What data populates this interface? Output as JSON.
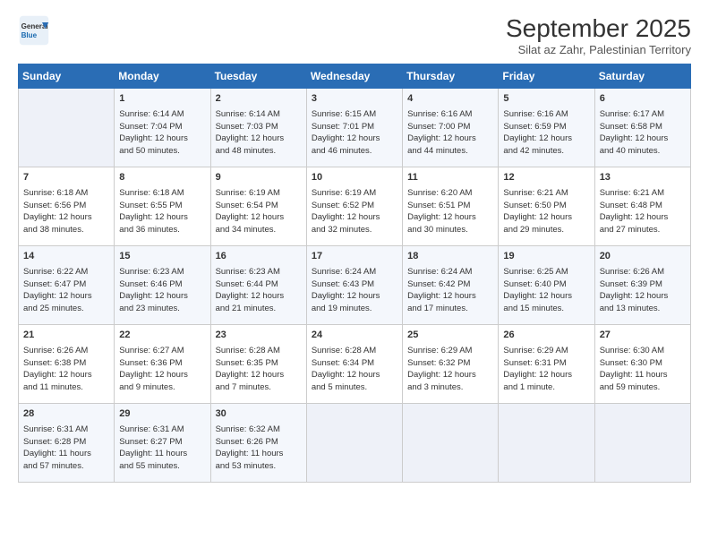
{
  "header": {
    "logo_general": "General",
    "logo_blue": "Blue",
    "month_title": "September 2025",
    "subtitle": "Silat az Zahr, Palestinian Territory"
  },
  "days_of_week": [
    "Sunday",
    "Monday",
    "Tuesday",
    "Wednesday",
    "Thursday",
    "Friday",
    "Saturday"
  ],
  "weeks": [
    [
      {
        "day": "",
        "info": ""
      },
      {
        "day": "1",
        "info": "Sunrise: 6:14 AM\nSunset: 7:04 PM\nDaylight: 12 hours\nand 50 minutes."
      },
      {
        "day": "2",
        "info": "Sunrise: 6:14 AM\nSunset: 7:03 PM\nDaylight: 12 hours\nand 48 minutes."
      },
      {
        "day": "3",
        "info": "Sunrise: 6:15 AM\nSunset: 7:01 PM\nDaylight: 12 hours\nand 46 minutes."
      },
      {
        "day": "4",
        "info": "Sunrise: 6:16 AM\nSunset: 7:00 PM\nDaylight: 12 hours\nand 44 minutes."
      },
      {
        "day": "5",
        "info": "Sunrise: 6:16 AM\nSunset: 6:59 PM\nDaylight: 12 hours\nand 42 minutes."
      },
      {
        "day": "6",
        "info": "Sunrise: 6:17 AM\nSunset: 6:58 PM\nDaylight: 12 hours\nand 40 minutes."
      }
    ],
    [
      {
        "day": "7",
        "info": "Sunrise: 6:18 AM\nSunset: 6:56 PM\nDaylight: 12 hours\nand 38 minutes."
      },
      {
        "day": "8",
        "info": "Sunrise: 6:18 AM\nSunset: 6:55 PM\nDaylight: 12 hours\nand 36 minutes."
      },
      {
        "day": "9",
        "info": "Sunrise: 6:19 AM\nSunset: 6:54 PM\nDaylight: 12 hours\nand 34 minutes."
      },
      {
        "day": "10",
        "info": "Sunrise: 6:19 AM\nSunset: 6:52 PM\nDaylight: 12 hours\nand 32 minutes."
      },
      {
        "day": "11",
        "info": "Sunrise: 6:20 AM\nSunset: 6:51 PM\nDaylight: 12 hours\nand 30 minutes."
      },
      {
        "day": "12",
        "info": "Sunrise: 6:21 AM\nSunset: 6:50 PM\nDaylight: 12 hours\nand 29 minutes."
      },
      {
        "day": "13",
        "info": "Sunrise: 6:21 AM\nSunset: 6:48 PM\nDaylight: 12 hours\nand 27 minutes."
      }
    ],
    [
      {
        "day": "14",
        "info": "Sunrise: 6:22 AM\nSunset: 6:47 PM\nDaylight: 12 hours\nand 25 minutes."
      },
      {
        "day": "15",
        "info": "Sunrise: 6:23 AM\nSunset: 6:46 PM\nDaylight: 12 hours\nand 23 minutes."
      },
      {
        "day": "16",
        "info": "Sunrise: 6:23 AM\nSunset: 6:44 PM\nDaylight: 12 hours\nand 21 minutes."
      },
      {
        "day": "17",
        "info": "Sunrise: 6:24 AM\nSunset: 6:43 PM\nDaylight: 12 hours\nand 19 minutes."
      },
      {
        "day": "18",
        "info": "Sunrise: 6:24 AM\nSunset: 6:42 PM\nDaylight: 12 hours\nand 17 minutes."
      },
      {
        "day": "19",
        "info": "Sunrise: 6:25 AM\nSunset: 6:40 PM\nDaylight: 12 hours\nand 15 minutes."
      },
      {
        "day": "20",
        "info": "Sunrise: 6:26 AM\nSunset: 6:39 PM\nDaylight: 12 hours\nand 13 minutes."
      }
    ],
    [
      {
        "day": "21",
        "info": "Sunrise: 6:26 AM\nSunset: 6:38 PM\nDaylight: 12 hours\nand 11 minutes."
      },
      {
        "day": "22",
        "info": "Sunrise: 6:27 AM\nSunset: 6:36 PM\nDaylight: 12 hours\nand 9 minutes."
      },
      {
        "day": "23",
        "info": "Sunrise: 6:28 AM\nSunset: 6:35 PM\nDaylight: 12 hours\nand 7 minutes."
      },
      {
        "day": "24",
        "info": "Sunrise: 6:28 AM\nSunset: 6:34 PM\nDaylight: 12 hours\nand 5 minutes."
      },
      {
        "day": "25",
        "info": "Sunrise: 6:29 AM\nSunset: 6:32 PM\nDaylight: 12 hours\nand 3 minutes."
      },
      {
        "day": "26",
        "info": "Sunrise: 6:29 AM\nSunset: 6:31 PM\nDaylight: 12 hours\nand 1 minute."
      },
      {
        "day": "27",
        "info": "Sunrise: 6:30 AM\nSunset: 6:30 PM\nDaylight: 11 hours\nand 59 minutes."
      }
    ],
    [
      {
        "day": "28",
        "info": "Sunrise: 6:31 AM\nSunset: 6:28 PM\nDaylight: 11 hours\nand 57 minutes."
      },
      {
        "day": "29",
        "info": "Sunrise: 6:31 AM\nSunset: 6:27 PM\nDaylight: 11 hours\nand 55 minutes."
      },
      {
        "day": "30",
        "info": "Sunrise: 6:32 AM\nSunset: 6:26 PM\nDaylight: 11 hours\nand 53 minutes."
      },
      {
        "day": "",
        "info": ""
      },
      {
        "day": "",
        "info": ""
      },
      {
        "day": "",
        "info": ""
      },
      {
        "day": "",
        "info": ""
      }
    ]
  ]
}
